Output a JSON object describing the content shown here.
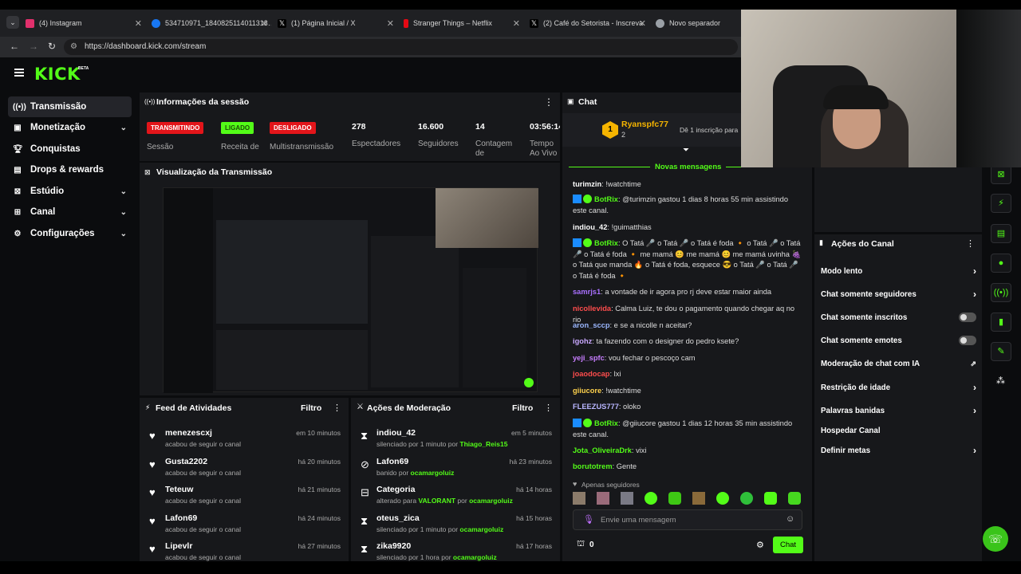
{
  "browser": {
    "tabs": [
      {
        "title": "(4) Instagram",
        "color": "#e1306c"
      },
      {
        "title": "534710971_1840825114011313…",
        "color": "#1877f2"
      },
      {
        "title": "(1) Página Inicial / X",
        "color": "#ffffff"
      },
      {
        "title": "Stranger Things – Netflix",
        "color": "#e50914"
      },
      {
        "title": "(2) Café do Setorista - Inscreva",
        "color": "#ffffff"
      },
      {
        "title": "Novo separador",
        "color": "#9aa0a6"
      }
    ],
    "url": "https://dashboard.kick.com/stream"
  },
  "brand": {
    "logo": "KICK",
    "beta": "BETA",
    "accent": "#53fc18"
  },
  "sidebar": {
    "items": [
      {
        "label": "Transmissão",
        "icon": "broadcast-icon",
        "active": true
      },
      {
        "label": "Monetização",
        "icon": "money-icon",
        "expand": true
      },
      {
        "label": "Conquistas",
        "icon": "trophy-icon"
      },
      {
        "label": "Drops & rewards",
        "icon": "gift-icon"
      },
      {
        "label": "Estúdio",
        "icon": "studio-icon",
        "expand": true
      },
      {
        "label": "Canal",
        "icon": "channel-icon",
        "expand": true
      },
      {
        "label": "Configurações",
        "icon": "gear-icon",
        "expand": true
      }
    ]
  },
  "session": {
    "title": "Informações da sessão",
    "badges": [
      {
        "text": "TRANSMITINDO",
        "label": "Sessão",
        "bg": "#e3151a"
      },
      {
        "text": "LIGADO",
        "label": "Receita de",
        "bg": "#53fc18"
      },
      {
        "text": "DESLIGADO",
        "label": "Multistransmissão",
        "bg": "#e3151a"
      }
    ],
    "stats": [
      {
        "value": "278",
        "label": "Espectadores"
      },
      {
        "value": "16.600",
        "label": "Seguidores"
      },
      {
        "value": "14",
        "label": "Contagem de"
      },
      {
        "value": "03:56:14",
        "label": "Tempo Ao Vivo"
      }
    ]
  },
  "preview": {
    "title": "Visualização da Transmissão"
  },
  "feed": {
    "title": "Feed de Atividades",
    "filter": "Filtro",
    "items": [
      {
        "name": "menezescxj",
        "sub": "acabou de seguir o canal",
        "time": "em 10 minutos"
      },
      {
        "name": "Gusta2202",
        "sub": "acabou de seguir o canal",
        "time": "há 20 minutos"
      },
      {
        "name": "Teteuw",
        "sub": "acabou de seguir o canal",
        "time": "há 21 minutos"
      },
      {
        "name": "Lafon69",
        "sub": "acabou de seguir o canal",
        "time": "há 24 minutos"
      },
      {
        "name": "Lipevlr",
        "sub": "acabou de seguir o canal",
        "time": "há 27 minutos"
      }
    ]
  },
  "moderation": {
    "title": "Ações de Moderação",
    "filter": "Filtro",
    "items": [
      {
        "name": "indiou_42",
        "sub": "silenciado por 1 minuto por ",
        "who": "Thiago_Reis15",
        "time": "em 5 minutos",
        "icon": "hourglass-icon"
      },
      {
        "name": "Lafon69",
        "sub": "banido por ",
        "who": "ocamargoluiz",
        "time": "há 23 minutos",
        "icon": "ban-icon"
      },
      {
        "name": "Categoria",
        "sub": "alterado para ",
        "who": "VALORANT",
        "who2": " por ",
        "who3": "ocamargoluiz",
        "time": "há 14 horas",
        "icon": "category-icon"
      },
      {
        "name": "oteus_zica",
        "sub": "silenciado por 1 minuto por ",
        "who": "ocamargoluiz",
        "time": "há 15 horas",
        "icon": "hourglass-icon"
      },
      {
        "name": "zika9920",
        "sub": "silenciado por 1 hora por ",
        "who": "ocamargoluiz",
        "time": "há 17 horas",
        "icon": "hourglass-icon"
      }
    ]
  },
  "chat": {
    "title": "Chat",
    "pinned_user": "Ryanspfc77",
    "pinned_count": "2",
    "pinned_sub": "Dê 1 inscrição para",
    "new_messages": "Novas mensagens",
    "messages": [
      {
        "user": "turimzin",
        "color": "#ffffff",
        "text": ": !watchtime"
      },
      {
        "user": "BotRix",
        "color": "#53fc18",
        "text": ": @turimzin gastou 1 dias 8 horas 55 min assistindo este canal.",
        "bot": true
      },
      {
        "user": "indiou_42",
        "color": "#ffffff",
        "text": ": !guimatthias"
      },
      {
        "user": "BotRix",
        "color": "#53fc18",
        "text": ": O Tatá 🎤 o Tatá 🎤 o Tatá é foda 🔸 o Tatá 🎤 o Tatá 🎤 o Tatá é foda 🔸 me mamá 😊 me mamá 😊 me mamá uvinha 🍇 o Tatá que manda 🔥 o Tatá é foda, esquece 😎 o Tatá 🎤 o Tatá 🎤 o Tatá é foda 🔸",
        "bot": true
      },
      {
        "user": "samrjs1",
        "color": "#a970ff",
        "text": ": a vontade de ir agora pro rj deve estar maior ainda"
      },
      {
        "user": "nicollevida",
        "color": "#ff4d4d",
        "text": ": Calma Luiz, te dou o pagamento quando chegar aq no rio"
      },
      {
        "user": "aron_sccp",
        "color": "#9bb7ff",
        "text": ": e se a nicolle n aceitar?"
      },
      {
        "user": "igohz",
        "color": "#c9a8ff",
        "text": ": ta fazendo com o designer do pedro ksete?"
      },
      {
        "user": "yeji_spfc",
        "color": "#c77dff",
        "text": ": vou fechar o pescoço cam"
      },
      {
        "user": "joaodocap",
        "color": "#ff4d4d",
        "text": ": lxi"
      },
      {
        "user": "giiucore",
        "color": "#ffd24d",
        "text": ": !watchtime"
      },
      {
        "user": "FLEEZUS777",
        "color": "#b9b6ff",
        "text": ": oloko"
      },
      {
        "user": "BotRix",
        "color": "#53fc18",
        "text": ": @giiucore gastou 1 dias 12 horas 35 min assistindo este canal.",
        "bot": true
      },
      {
        "user": "Jota_OliveiraDrk",
        "color": "#53fc18",
        "text": ": vixi"
      },
      {
        "user": "borutotrem",
        "color": "#53fc18",
        "text": ": Gente"
      }
    ],
    "followers_only": "Apenas seguidores",
    "placeholder": "Envie uma mensagem",
    "count": "0",
    "send": "Chat"
  },
  "channel_actions": {
    "title": "Ações do Canal",
    "items": [
      {
        "label": "Modo lento",
        "kind": "arrow"
      },
      {
        "label": "Chat somente seguidores",
        "kind": "arrow"
      },
      {
        "label": "Chat somente inscritos",
        "kind": "toggle"
      },
      {
        "label": "Chat somente emotes",
        "kind": "toggle"
      },
      {
        "label": "Moderação de chat com IA",
        "kind": "ext"
      },
      {
        "label": "Restrição de idade",
        "kind": "arrow"
      },
      {
        "label": "Palavras banidas",
        "kind": "arrow"
      },
      {
        "label": "Hospedar Canal",
        "kind": "none"
      },
      {
        "label": "Definir metas",
        "kind": "arrow"
      }
    ]
  }
}
